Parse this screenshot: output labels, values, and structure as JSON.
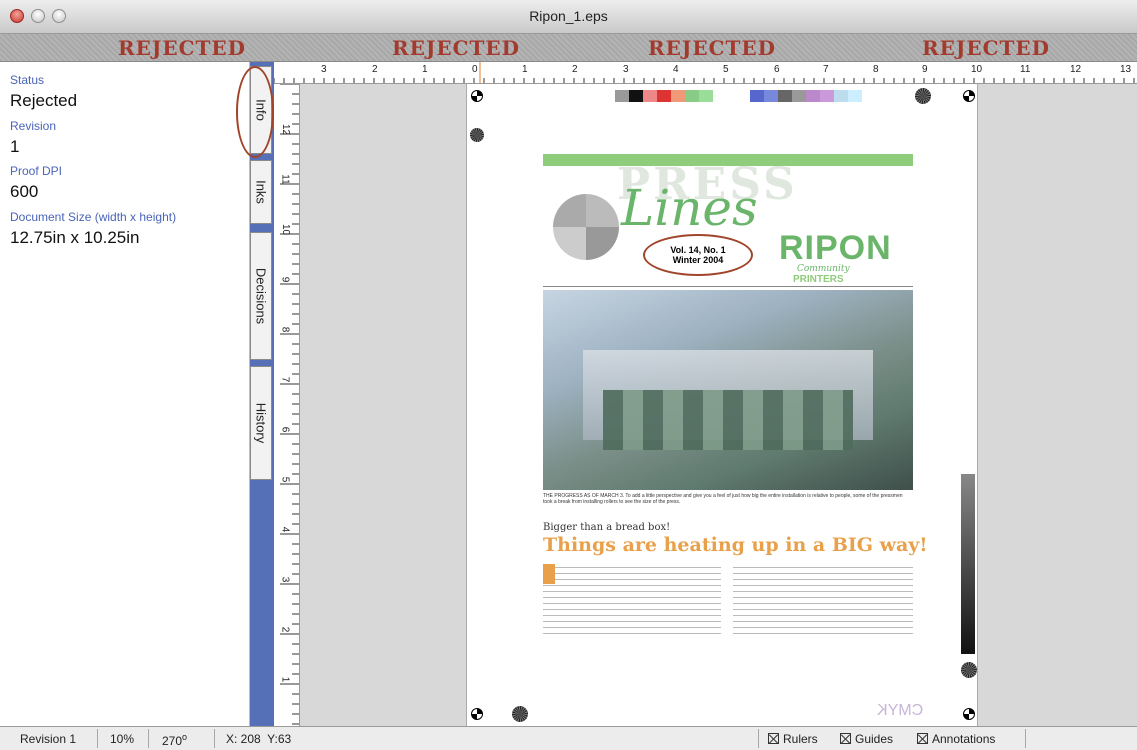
{
  "window": {
    "title": "Ripon_1.eps"
  },
  "banner": {
    "labels": [
      "REJECTED",
      "REJECTED",
      "REJECTED",
      "REJECTED"
    ]
  },
  "info": {
    "status_label": "Status",
    "status_value": "Rejected",
    "revision_label": "Revision",
    "revision_value": "1",
    "dpi_label": "Proof DPI",
    "dpi_value": "600",
    "docsize_label": "Document Size (width x height)",
    "docsize_value": "12.75in x 10.25in"
  },
  "tabs": [
    "Info",
    "Inks",
    "Decisions",
    "History"
  ],
  "rulers": {
    "horizontal": [
      "3",
      "2",
      "1",
      "0",
      "1",
      "2",
      "3",
      "4",
      "5",
      "6",
      "7",
      "8",
      "9",
      "10",
      "11",
      "12",
      "13"
    ],
    "vertical": [
      "12",
      "11",
      "10",
      "9",
      "8",
      "7",
      "6",
      "5",
      "4",
      "3",
      "2",
      "1"
    ]
  },
  "document": {
    "masthead": "Lines",
    "overlay_word": "PRESS",
    "issue": "Vol. 14, No. 1",
    "issue_date": "Winter 2004",
    "brand": "RIPON",
    "brand_sub": "Community",
    "brand_sub2": "PRINTERS",
    "caption": "THE PROGRESS AS OF MARCH 3. To add a little perspective and give you a feel of just how big the entire installation is relative to people, some of the pressmen took a break from installing rollers to see the size of the press.",
    "kicker": "Bigger than a bread box!",
    "headline": "Things are heating up in a BIG way!",
    "footer_mark": "CMYK"
  },
  "colors": {
    "accent_green": "#8fcc7c",
    "headline_orange": "#e8a14a",
    "circle_red": "#a0452a",
    "tab_blue": "#5670b8",
    "banner_red": "#a33a2e"
  },
  "status": {
    "revision": "Revision 1",
    "zoom": "10%",
    "rotation": "270",
    "rotation_unit": "o",
    "coords": "X: 208  Y:63",
    "rulers_label": "Rulers",
    "guides_label": "Guides",
    "annotations_label": "Annotations"
  }
}
